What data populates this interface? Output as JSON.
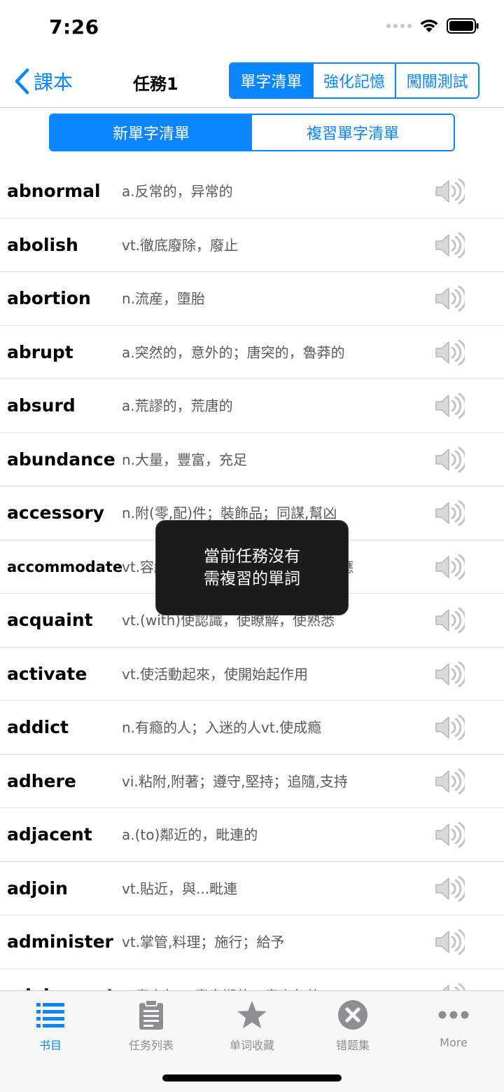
{
  "status_bar": {
    "time": "7:26"
  },
  "nav": {
    "back_label": "課本",
    "title": "任務1",
    "segments": [
      {
        "label": "單字清單",
        "active": true
      },
      {
        "label": "強化記憶",
        "active": false
      },
      {
        "label": "闖關測試",
        "active": false
      }
    ]
  },
  "sub_segments": [
    {
      "label": "新單字清單",
      "active": true
    },
    {
      "label": "複習單字清單",
      "active": false
    }
  ],
  "words": [
    {
      "word": "abnormal",
      "meaning": "a.反常的，异常的"
    },
    {
      "word": "abolish",
      "meaning": "vt.徹底廢除，廢止"
    },
    {
      "word": "abortion",
      "meaning": "n.流産，墮胎"
    },
    {
      "word": "abrupt",
      "meaning": "a.突然的，意外的；唐突的，魯莽的"
    },
    {
      "word": "absurd",
      "meaning": "a.荒謬的，荒唐的"
    },
    {
      "word": "abundance",
      "meaning": "n.大量，豐富，充足"
    },
    {
      "word": "accessory",
      "meaning": "n.附(零,配)件；裝飾品；同謀,幫凶"
    },
    {
      "word": "accommodate",
      "meaning": "vt.容納；向...提供住處；使適應,順應"
    },
    {
      "word": "acquaint",
      "meaning": "vt.(with)使認識，使瞭解，使熟悉"
    },
    {
      "word": "activate",
      "meaning": "vt.使活動起來，使開始起作用"
    },
    {
      "word": "addict",
      "meaning": "n.有瘾的人；入迷的人vt.使成瘾"
    },
    {
      "word": "adhere",
      "meaning": "vi.粘附,附著；遵守,堅持；追隨,支持"
    },
    {
      "word": "adjacent",
      "meaning": "a.(to)鄰近的，毗連的"
    },
    {
      "word": "adjoin",
      "meaning": "vt.貼近，與...毗連"
    },
    {
      "word": "administer",
      "meaning": "vt.掌管,料理；施行；給予"
    },
    {
      "word": "adolescent",
      "meaning": "n.青少年 a.青春期的，青少年的"
    }
  ],
  "toast": {
    "line1": "當前任務沒有",
    "line2": "需複習的單詞"
  },
  "tabs": [
    {
      "label": "书目",
      "icon": "list-icon",
      "active": true
    },
    {
      "label": "任务列表",
      "icon": "clipboard-icon",
      "active": false
    },
    {
      "label": "单词收藏",
      "icon": "star-icon",
      "active": false
    },
    {
      "label": "错题集",
      "icon": "x-circle-icon",
      "active": false
    },
    {
      "label": "More",
      "icon": "more-icon",
      "active": false
    }
  ],
  "colors": {
    "accent": "#0a84ff",
    "tab_inactive": "#8e8e93"
  }
}
